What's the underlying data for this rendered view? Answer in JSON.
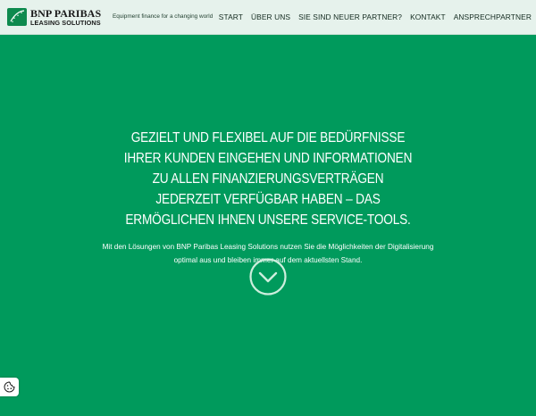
{
  "header": {
    "logo": {
      "name": "BNP PARIBAS",
      "sub": "LEASING SOLUTIONS",
      "icon": "bnp-stars-logo-icon"
    },
    "tagline": "Equipment finance for a changing world",
    "nav": [
      {
        "label": "START"
      },
      {
        "label": "ÜBER UNS"
      },
      {
        "label": "SIE SIND NEUER PARTNER?"
      },
      {
        "label": "KONTAKT"
      },
      {
        "label": "ANSPRECHPARTNER"
      }
    ]
  },
  "hero": {
    "headline": "GEZIELT UND FLEXIBEL AUF DIE BEDÜRFNISSE IHRER KUNDEN EINGEHEN UND INFORMATIONEN ZU ALLEN FINANZIERUNGSVERTRÄGEN JEDERZEIT VERFÜGBAR HABEN – DAS ERMÖGLICHEN IHNEN UNSERE SERVICE-TOOLS.",
    "subtext": "Mit den Lösungen von BNP Paribas Leasing Solutions nutzen Sie die Möglichkeiten der Digitalisierung optimal aus und bleiben immer auf dem aktuellsten Stand.",
    "scroll_icon": "chevron-down-circle-icon"
  },
  "cookie": {
    "icon": "cookie-icon"
  },
  "colors": {
    "background": "#009a5c",
    "header_bg": "#e6f2ec",
    "text_light": "#ffffff",
    "nav_text": "#142b20"
  }
}
